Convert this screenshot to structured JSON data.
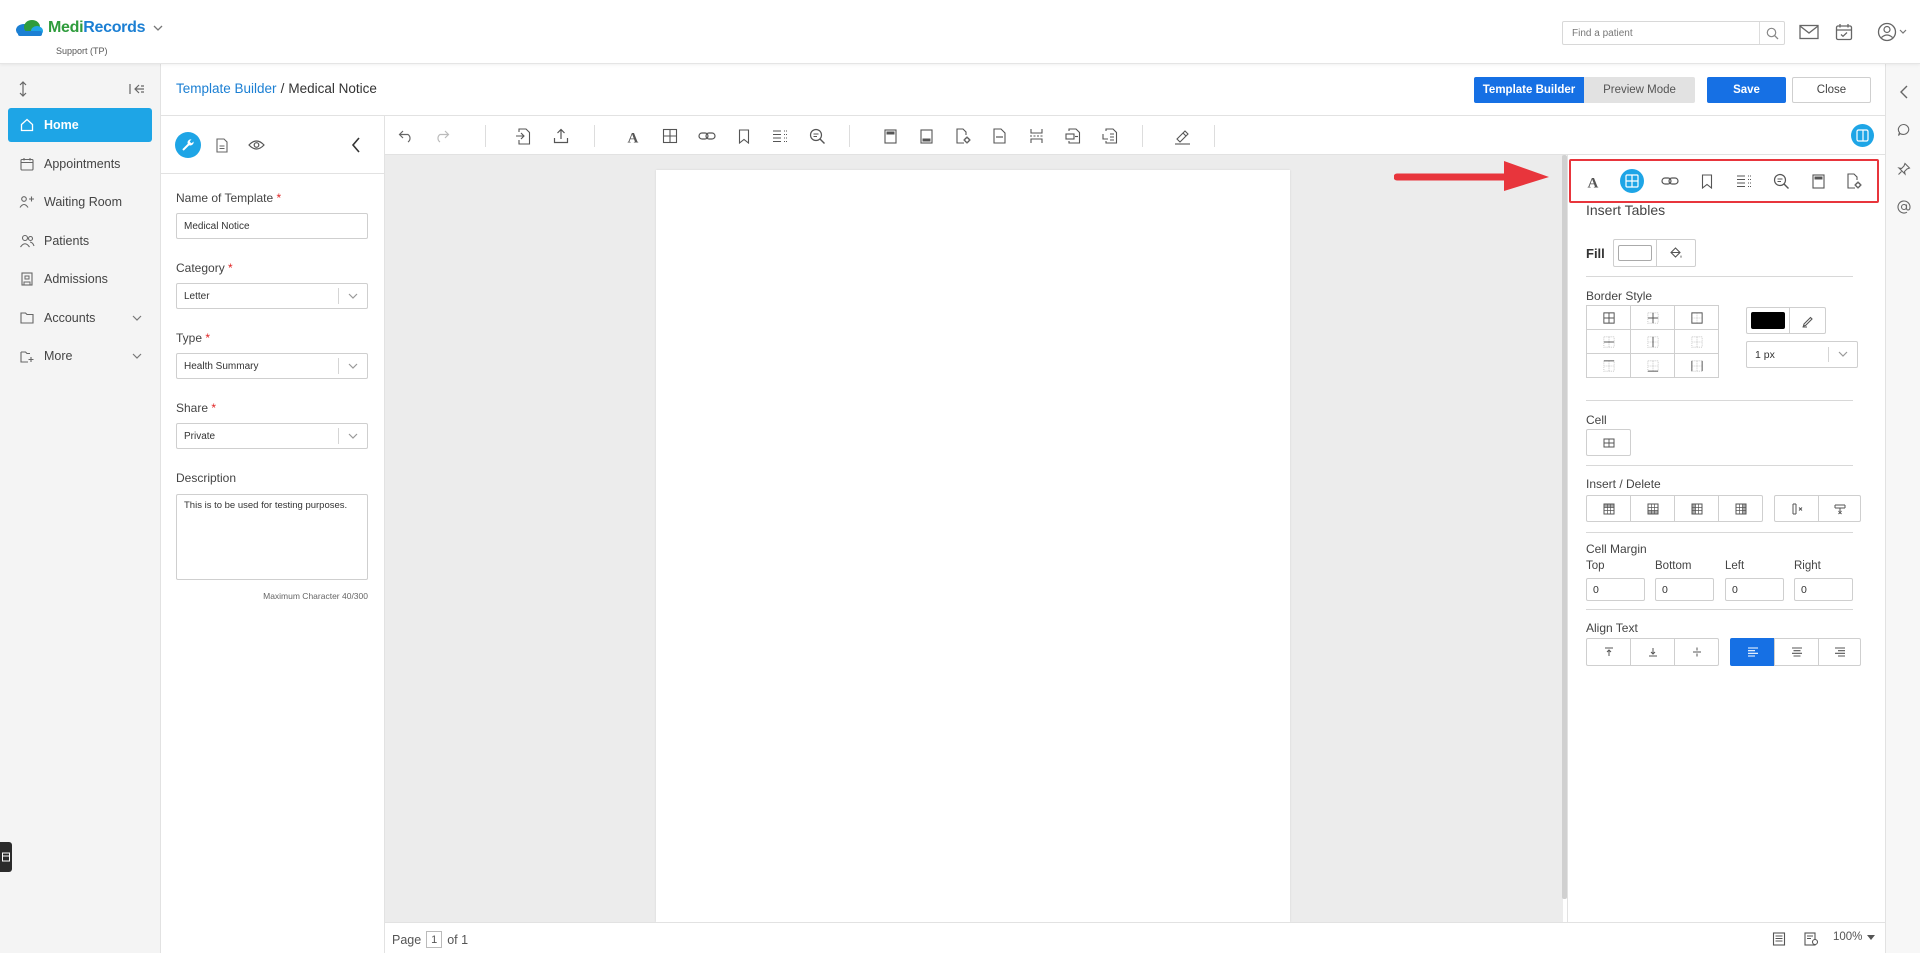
{
  "app": {
    "logo_medi": "Medi",
    "logo_records": "Records",
    "org": "Support (TP)",
    "search_placeholder": "Find a patient"
  },
  "nav": {
    "home": "Home",
    "appointments": "Appointments",
    "waiting_room": "Waiting Room",
    "patients": "Patients",
    "admissions": "Admissions",
    "accounts": "Accounts",
    "more": "More"
  },
  "header": {
    "breadcrumb_link": "Template Builder",
    "breadcrumb_sep": "/",
    "breadcrumb_current": "Medical Notice",
    "template_builder_btn": "Template Builder",
    "preview_mode_btn": "Preview Mode",
    "save_btn": "Save",
    "close_btn": "Close"
  },
  "form": {
    "name_label": "Name of Template",
    "name_value": "Medical Notice",
    "category_label": "Category",
    "category_value": "Letter",
    "type_label": "Type",
    "type_value": "Health Summary",
    "share_label": "Share",
    "share_value": "Private",
    "description_label": "Description",
    "description_value": "This is to be used for testing purposes.",
    "char_count": "Maximum Character 40/300",
    "required_mark": "*"
  },
  "status": {
    "page_label": "Page",
    "page_current": "1",
    "page_total": "of 1",
    "zoom": "100%"
  },
  "props": {
    "title": "Insert Tables",
    "fill_label": "Fill",
    "border_style_label": "Border Style",
    "border_width": "1 px",
    "cell_label": "Cell",
    "insert_delete_label": "Insert / Delete",
    "cell_margin_label": "Cell Margin",
    "margin_top_label": "Top",
    "margin_bottom_label": "Bottom",
    "margin_left_label": "Left",
    "margin_right_label": "Right",
    "margin_top": "0",
    "margin_bottom": "0",
    "margin_left": "0",
    "margin_right": "0",
    "align_text_label": "Align Text"
  },
  "colors": {
    "primary": "#1670e4",
    "accent": "#1ea5e6",
    "highlight_border": "#e8353c",
    "border_color_swatch": "#000000",
    "fill_swatch": "#ffffff"
  }
}
